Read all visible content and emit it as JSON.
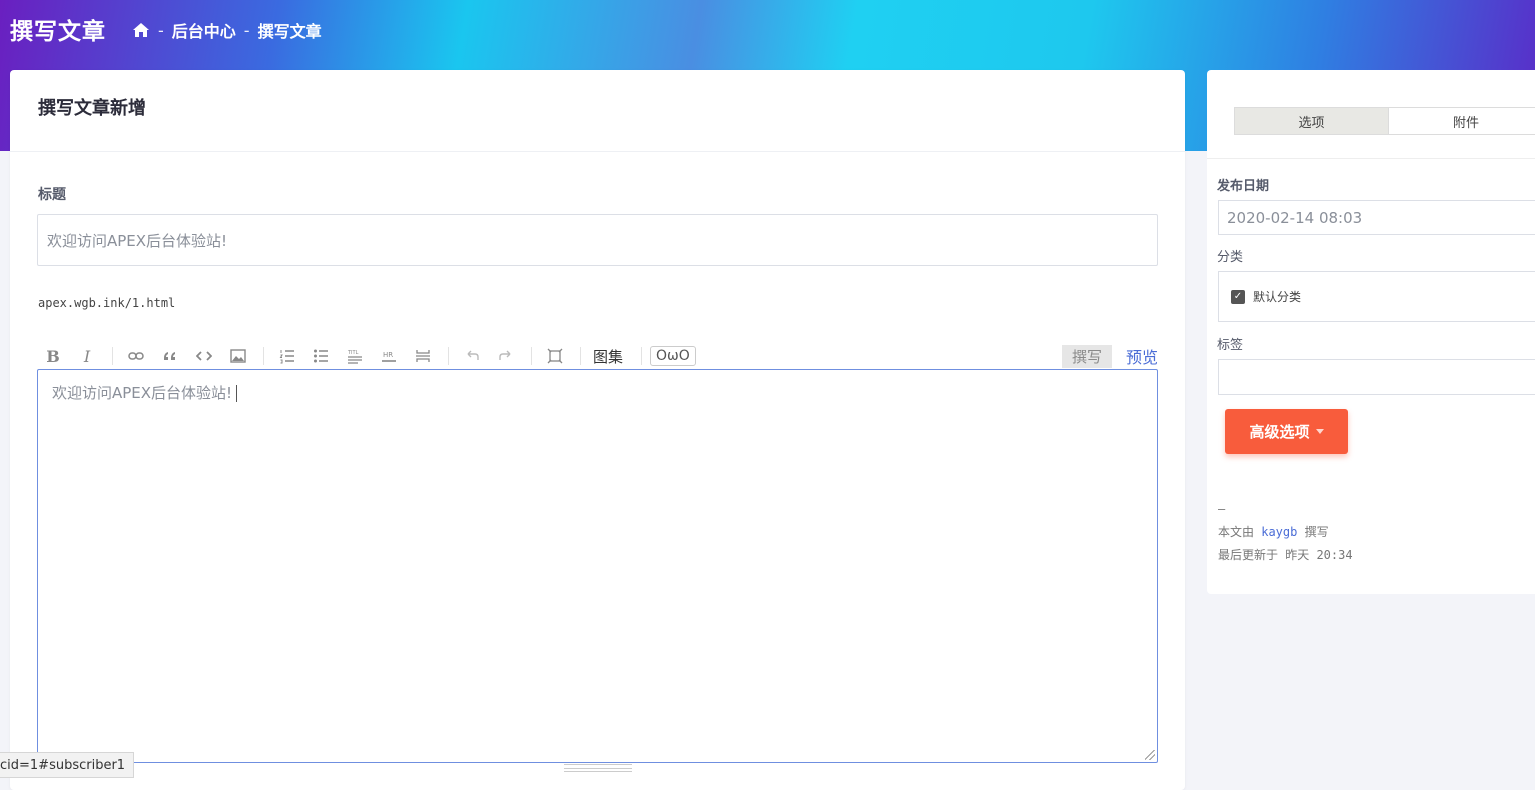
{
  "header": {
    "title": "撰写文章",
    "breadcrumb": {
      "sep": "-",
      "items": [
        "后台中心",
        "撰写文章"
      ]
    }
  },
  "editor_card": {
    "heading": "撰写文章新增",
    "title_label": "标题",
    "title_value": "欢迎访问APEX后台体验站!",
    "slug": "apex.wgb.ink/1.html",
    "toolbar": {
      "bold": "B",
      "italic": "I",
      "gallery": "图集",
      "owo": "OωO",
      "write": "撰写",
      "preview": "预览"
    },
    "content": "欢迎访问APEX后台体验站!"
  },
  "sidebar": {
    "tabs": [
      "选项",
      "附件"
    ],
    "publish_date_label": "发布日期",
    "publish_date_value": "2020-02-14 08:03",
    "category_label": "分类",
    "category_option": "默认分类",
    "tags_label": "标签",
    "advanced_button": "高级选项",
    "meta": {
      "dash": "—",
      "author_prefix": "本文由 ",
      "author": "kaygb",
      "author_suffix": " 撰写",
      "updated_prefix": "最后更新于 ",
      "updated": "昨天 20:34"
    }
  },
  "status_bar": {
    "url": "cid=1#subscriber1"
  },
  "colors": {
    "accent": "#4a6cd6",
    "button": "#f85c3c"
  }
}
